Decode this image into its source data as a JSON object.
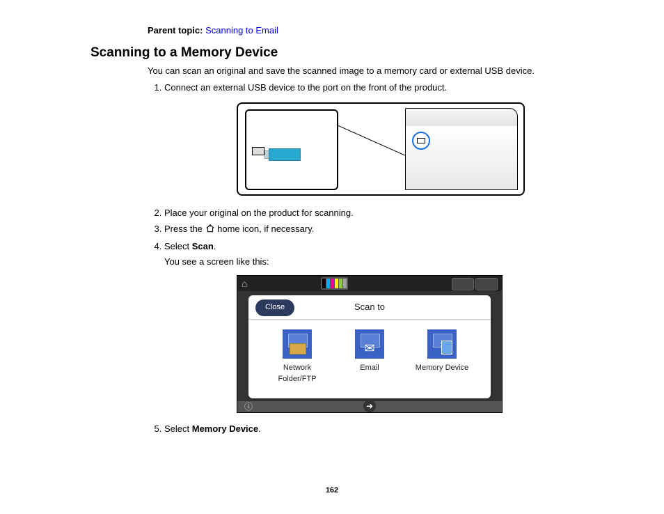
{
  "parent_topic": {
    "label": "Parent topic:",
    "link_text": "Scanning to Email"
  },
  "heading": "Scanning to a Memory Device",
  "intro": "You can scan an original and save the scanned image to a memory card or external USB device.",
  "steps": {
    "s1": "Connect an external USB device to the port on the front of the product.",
    "s2": "Place your original on the product for scanning.",
    "s3_pre": "Press the ",
    "s3_post": " home icon, if necessary.",
    "s4_pre": "Select ",
    "s4_bold": "Scan",
    "s4_post": ".",
    "s4_sub": "You see a screen like this:",
    "s5_pre": "Select ",
    "s5_bold": "Memory Device",
    "s5_post": "."
  },
  "screen": {
    "close_label": "Close",
    "title": "Scan to",
    "items": [
      {
        "label": "Network Folder/FTP"
      },
      {
        "label": "Email"
      },
      {
        "label": "Memory Device"
      }
    ],
    "ink_colors": [
      "#000000",
      "#00aeef",
      "#ec008c",
      "#fff200",
      "#8dc63f",
      "#a0a0a0"
    ]
  },
  "page_number": "162"
}
